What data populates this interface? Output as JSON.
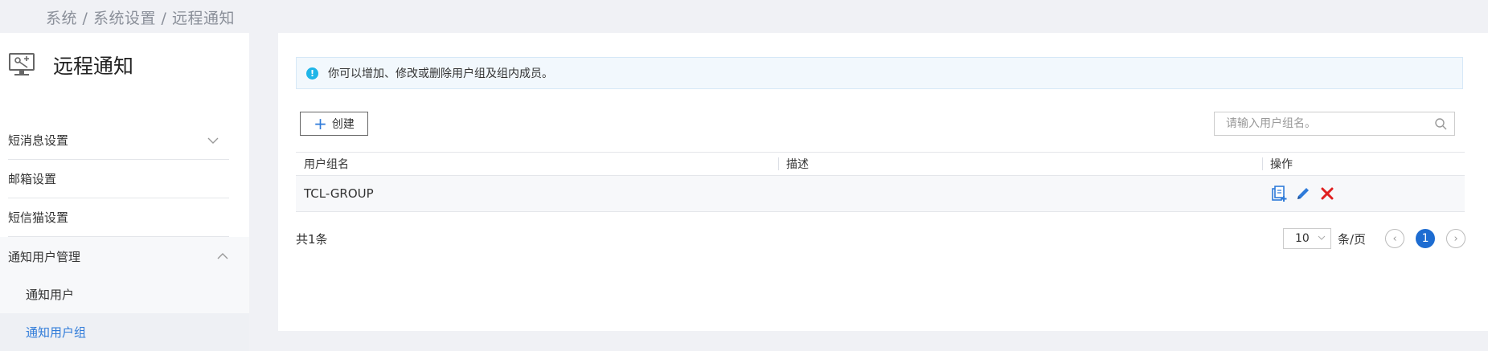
{
  "breadcrumb": "系统 / 系统设置 / 远程通知",
  "sidebar": {
    "title": "远程通知",
    "title_icon": "remote-monitor-icon",
    "items": [
      {
        "label": "短消息设置",
        "expandable": true,
        "expanded": false
      },
      {
        "label": "邮箱设置"
      },
      {
        "label": "短信猫设置"
      },
      {
        "label": "通知用户管理",
        "expandable": true,
        "expanded": true
      }
    ],
    "sub_items": [
      {
        "label": "通知用户",
        "active": false
      },
      {
        "label": "通知用户组",
        "active": true
      }
    ]
  },
  "notice": {
    "text": "你可以增加、修改或删除用户组及组内成员。"
  },
  "toolbar": {
    "create_label": "创建",
    "search_placeholder": "请输入用户组名。"
  },
  "table": {
    "headers": [
      "用户组名",
      "描述",
      "操作"
    ],
    "rows": [
      {
        "name": "TCL-GROUP",
        "description": ""
      }
    ]
  },
  "pagination": {
    "total": "共1条",
    "page_size": "10",
    "per_page_label": "条/页",
    "current_page": "1"
  },
  "colors": {
    "accent": "#1d6cd1",
    "link": "#2f7bd9",
    "delete": "#e02020",
    "info": "#1fb5e8"
  }
}
